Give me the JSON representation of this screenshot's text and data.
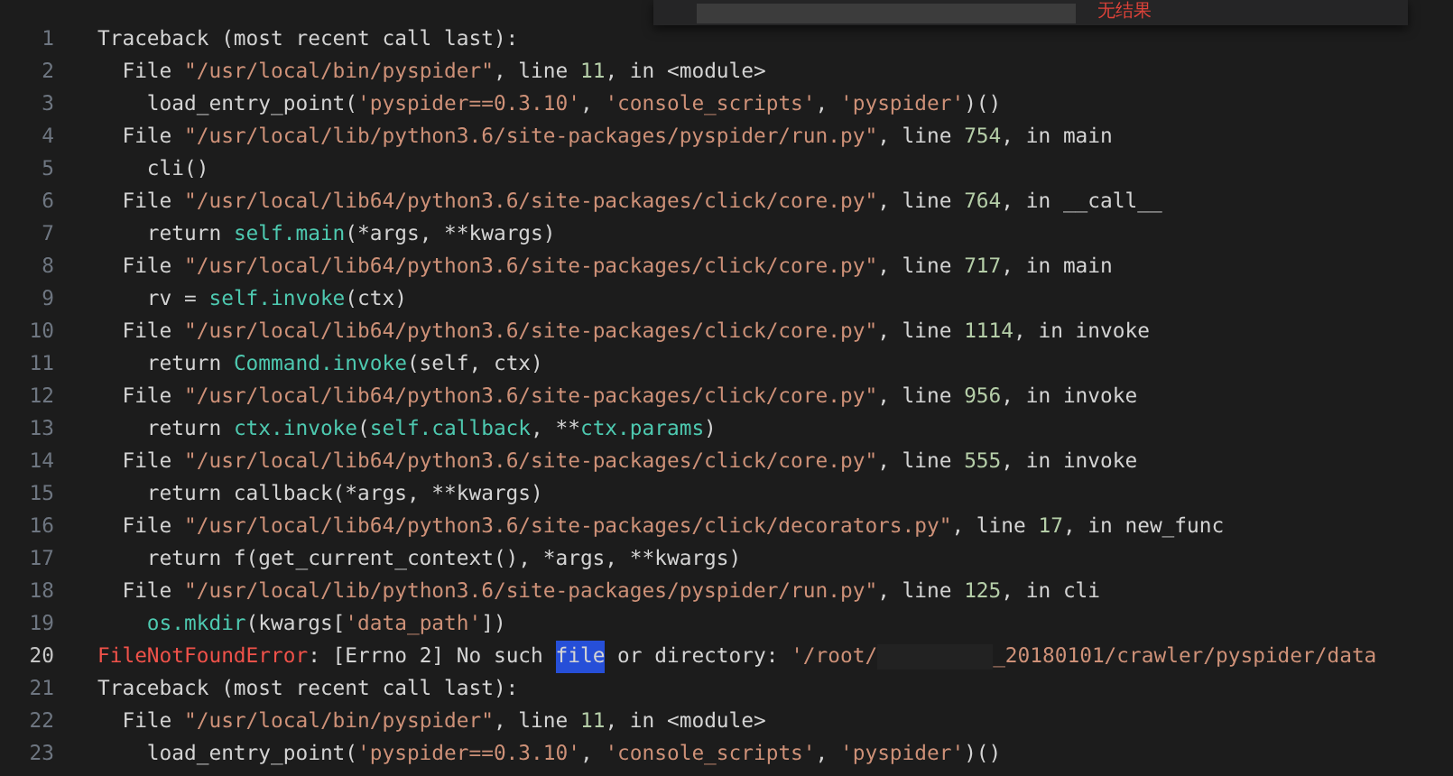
{
  "find_widget": {
    "status": "无结果"
  },
  "lines": [
    {
      "number": "1",
      "current": false,
      "tokens": [
        {
          "kind": "text",
          "text": "Traceback (most recent call last):"
        }
      ]
    },
    {
      "number": "2",
      "current": false,
      "tokens": [
        {
          "kind": "text",
          "text": "  File "
        },
        {
          "kind": "string",
          "text": "\"/usr/local/bin/pyspider\""
        },
        {
          "kind": "text",
          "text": ", line "
        },
        {
          "kind": "number",
          "text": "11"
        },
        {
          "kind": "text",
          "text": ", in <module>"
        }
      ]
    },
    {
      "number": "3",
      "current": false,
      "tokens": [
        {
          "kind": "text",
          "text": "    load_entry_point("
        },
        {
          "kind": "string",
          "text": "'pyspider==0.3.10'"
        },
        {
          "kind": "text",
          "text": ", "
        },
        {
          "kind": "string",
          "text": "'console_scripts'"
        },
        {
          "kind": "text",
          "text": ", "
        },
        {
          "kind": "string",
          "text": "'pyspider'"
        },
        {
          "kind": "text",
          "text": ")()"
        }
      ]
    },
    {
      "number": "4",
      "current": false,
      "tokens": [
        {
          "kind": "text",
          "text": "  File "
        },
        {
          "kind": "string",
          "text": "\"/usr/local/lib/python3.6/site-packages/pyspider/run.py\""
        },
        {
          "kind": "text",
          "text": ", line "
        },
        {
          "kind": "number",
          "text": "754"
        },
        {
          "kind": "text",
          "text": ", in main"
        }
      ]
    },
    {
      "number": "5",
      "current": false,
      "tokens": [
        {
          "kind": "text",
          "text": "    cli()"
        }
      ]
    },
    {
      "number": "6",
      "current": false,
      "tokens": [
        {
          "kind": "text",
          "text": "  File "
        },
        {
          "kind": "string",
          "text": "\"/usr/local/lib64/python3.6/site-packages/click/core.py\""
        },
        {
          "kind": "text",
          "text": ", line "
        },
        {
          "kind": "number",
          "text": "764"
        },
        {
          "kind": "text",
          "text": ", in __call__"
        }
      ]
    },
    {
      "number": "7",
      "current": false,
      "tokens": [
        {
          "kind": "text",
          "text": "    return "
        },
        {
          "kind": "call",
          "text": "self.main"
        },
        {
          "kind": "text",
          "text": "(*args, **kwargs)"
        }
      ]
    },
    {
      "number": "8",
      "current": false,
      "tokens": [
        {
          "kind": "text",
          "text": "  File "
        },
        {
          "kind": "string",
          "text": "\"/usr/local/lib64/python3.6/site-packages/click/core.py\""
        },
        {
          "kind": "text",
          "text": ", line "
        },
        {
          "kind": "number",
          "text": "717"
        },
        {
          "kind": "text",
          "text": ", in main"
        }
      ]
    },
    {
      "number": "9",
      "current": false,
      "tokens": [
        {
          "kind": "text",
          "text": "    rv = "
        },
        {
          "kind": "call",
          "text": "self.invoke"
        },
        {
          "kind": "text",
          "text": "(ctx)"
        }
      ]
    },
    {
      "number": "10",
      "current": false,
      "tokens": [
        {
          "kind": "text",
          "text": "  File "
        },
        {
          "kind": "string",
          "text": "\"/usr/local/lib64/python3.6/site-packages/click/core.py\""
        },
        {
          "kind": "text",
          "text": ", line "
        },
        {
          "kind": "number",
          "text": "1114"
        },
        {
          "kind": "text",
          "text": ", in invoke"
        }
      ]
    },
    {
      "number": "11",
      "current": false,
      "tokens": [
        {
          "kind": "text",
          "text": "    return "
        },
        {
          "kind": "call",
          "text": "Command.invoke"
        },
        {
          "kind": "text",
          "text": "(self, ctx)"
        }
      ]
    },
    {
      "number": "12",
      "current": false,
      "tokens": [
        {
          "kind": "text",
          "text": "  File "
        },
        {
          "kind": "string",
          "text": "\"/usr/local/lib64/python3.6/site-packages/click/core.py\""
        },
        {
          "kind": "text",
          "text": ", line "
        },
        {
          "kind": "number",
          "text": "956"
        },
        {
          "kind": "text",
          "text": ", in invoke"
        }
      ]
    },
    {
      "number": "13",
      "current": false,
      "tokens": [
        {
          "kind": "text",
          "text": "    return "
        },
        {
          "kind": "call",
          "text": "ctx.invoke"
        },
        {
          "kind": "text",
          "text": "("
        },
        {
          "kind": "call",
          "text": "self.callback"
        },
        {
          "kind": "text",
          "text": ", **"
        },
        {
          "kind": "call",
          "text": "ctx.params"
        },
        {
          "kind": "text",
          "text": ")"
        }
      ]
    },
    {
      "number": "14",
      "current": false,
      "tokens": [
        {
          "kind": "text",
          "text": "  File "
        },
        {
          "kind": "string",
          "text": "\"/usr/local/lib64/python3.6/site-packages/click/core.py\""
        },
        {
          "kind": "text",
          "text": ", line "
        },
        {
          "kind": "number",
          "text": "555"
        },
        {
          "kind": "text",
          "text": ", in invoke"
        }
      ]
    },
    {
      "number": "15",
      "current": false,
      "tokens": [
        {
          "kind": "text",
          "text": "    return callback(*args, **kwargs)"
        }
      ]
    },
    {
      "number": "16",
      "current": false,
      "tokens": [
        {
          "kind": "text",
          "text": "  File "
        },
        {
          "kind": "string",
          "text": "\"/usr/local/lib64/python3.6/site-packages/click/decorators.py\""
        },
        {
          "kind": "text",
          "text": ", line "
        },
        {
          "kind": "number",
          "text": "17"
        },
        {
          "kind": "text",
          "text": ", in new_func"
        }
      ]
    },
    {
      "number": "17",
      "current": false,
      "tokens": [
        {
          "kind": "text",
          "text": "    return f(get_current_context(), *args, **kwargs)"
        }
      ]
    },
    {
      "number": "18",
      "current": false,
      "tokens": [
        {
          "kind": "text",
          "text": "  File "
        },
        {
          "kind": "string",
          "text": "\"/usr/local/lib/python3.6/site-packages/pyspider/run.py\""
        },
        {
          "kind": "text",
          "text": ", line "
        },
        {
          "kind": "number",
          "text": "125"
        },
        {
          "kind": "text",
          "text": ", in cli"
        }
      ]
    },
    {
      "number": "19",
      "current": false,
      "tokens": [
        {
          "kind": "call",
          "text": "    os.mkdir"
        },
        {
          "kind": "text",
          "text": "(kwargs["
        },
        {
          "kind": "string",
          "text": "'data_path'"
        },
        {
          "kind": "text",
          "text": "])"
        }
      ]
    },
    {
      "number": "20",
      "current": true,
      "tokens": [
        {
          "kind": "error",
          "text": "FileNotFoundError"
        },
        {
          "kind": "text",
          "text": ": [Errno 2] No such "
        },
        {
          "kind": "match",
          "text": "file"
        },
        {
          "kind": "text",
          "text": " or directory: "
        },
        {
          "kind": "string",
          "text": "'/root/"
        },
        {
          "kind": "redacted"
        },
        {
          "kind": "string",
          "text": "_20180101/crawler/pyspider/data"
        }
      ]
    },
    {
      "number": "21",
      "current": false,
      "tokens": [
        {
          "kind": "text",
          "text": "Traceback (most recent call last):"
        }
      ]
    },
    {
      "number": "22",
      "current": false,
      "tokens": [
        {
          "kind": "text",
          "text": "  File "
        },
        {
          "kind": "string",
          "text": "\"/usr/local/bin/pyspider\""
        },
        {
          "kind": "text",
          "text": ", line "
        },
        {
          "kind": "number",
          "text": "11"
        },
        {
          "kind": "text",
          "text": ", in <module>"
        }
      ]
    },
    {
      "number": "23",
      "current": false,
      "tokens": [
        {
          "kind": "text",
          "text": "    load_entry_point("
        },
        {
          "kind": "string",
          "text": "'pyspider==0.3.10'"
        },
        {
          "kind": "text",
          "text": ", "
        },
        {
          "kind": "string",
          "text": "'console_scripts'"
        },
        {
          "kind": "text",
          "text": ", "
        },
        {
          "kind": "string",
          "text": "'pyspider'"
        },
        {
          "kind": "text",
          "text": ")()"
        }
      ]
    }
  ]
}
